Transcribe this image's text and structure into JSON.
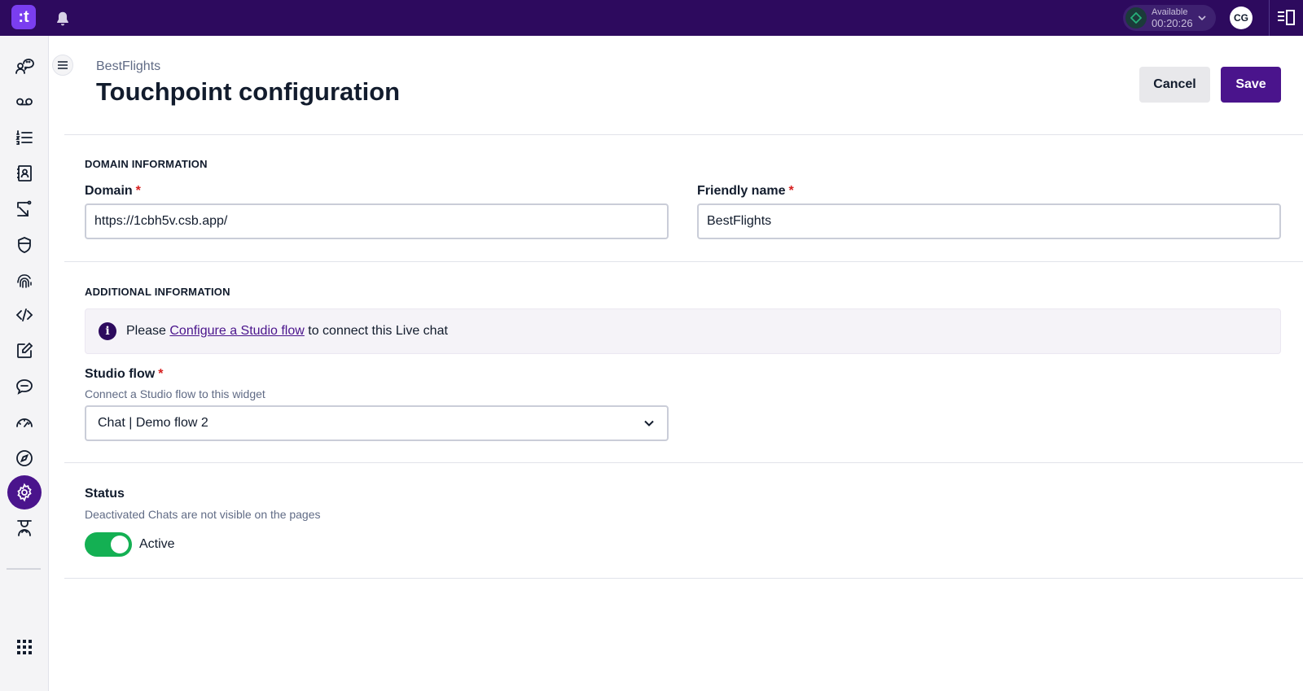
{
  "app": {
    "brand_mark": ":t",
    "status": {
      "label": "Available",
      "timer": "00:20:26"
    },
    "user_initials": "CG"
  },
  "sidebar": {
    "items": [
      {
        "icon": "people-chat-icon"
      },
      {
        "icon": "voicemail-icon"
      },
      {
        "icon": "numbered-list-icon"
      },
      {
        "icon": "contacts-book-icon"
      },
      {
        "icon": "flow-icon"
      },
      {
        "icon": "shield-icon"
      },
      {
        "icon": "fingerprint-icon"
      },
      {
        "icon": "code-icon"
      },
      {
        "icon": "edit-note-icon"
      },
      {
        "icon": "chat-bubble-icon"
      },
      {
        "icon": "gauge-icon"
      },
      {
        "icon": "compass-icon"
      },
      {
        "icon": "settings-icon",
        "active": true
      },
      {
        "icon": "agent-icon"
      }
    ],
    "apps_icon": "apps-grid-icon"
  },
  "page": {
    "breadcrumb": "BestFlights",
    "title": "Touchpoint configuration",
    "cancel_label": "Cancel",
    "save_label": "Save"
  },
  "domain_section": {
    "title": "DOMAIN INFORMATION",
    "domain_label": "Domain",
    "domain_value": "https://1cbh5v.csb.app/",
    "friendly_label": "Friendly name",
    "friendly_value": "BestFlights",
    "required_mark": "*"
  },
  "additional_section": {
    "title": "ADDITIONAL INFORMATION",
    "callout_prefix": "Please ",
    "callout_link": "Configure a Studio flow",
    "callout_suffix": " to connect this Live chat",
    "flow_label": "Studio flow",
    "flow_help": "Connect a Studio flow to this widget",
    "flow_selected": "Chat | Demo flow 2"
  },
  "status_section": {
    "title": "Status",
    "help": "Deactivated Chats are not visible on the pages",
    "toggle_on": true,
    "toggle_label": "Active"
  },
  "colors": {
    "topbar": "#2d0a5e",
    "brand": "#7a3ef0",
    "primary": "#4a148c",
    "toggle_on": "#14b053",
    "required": "#d61f1f"
  }
}
